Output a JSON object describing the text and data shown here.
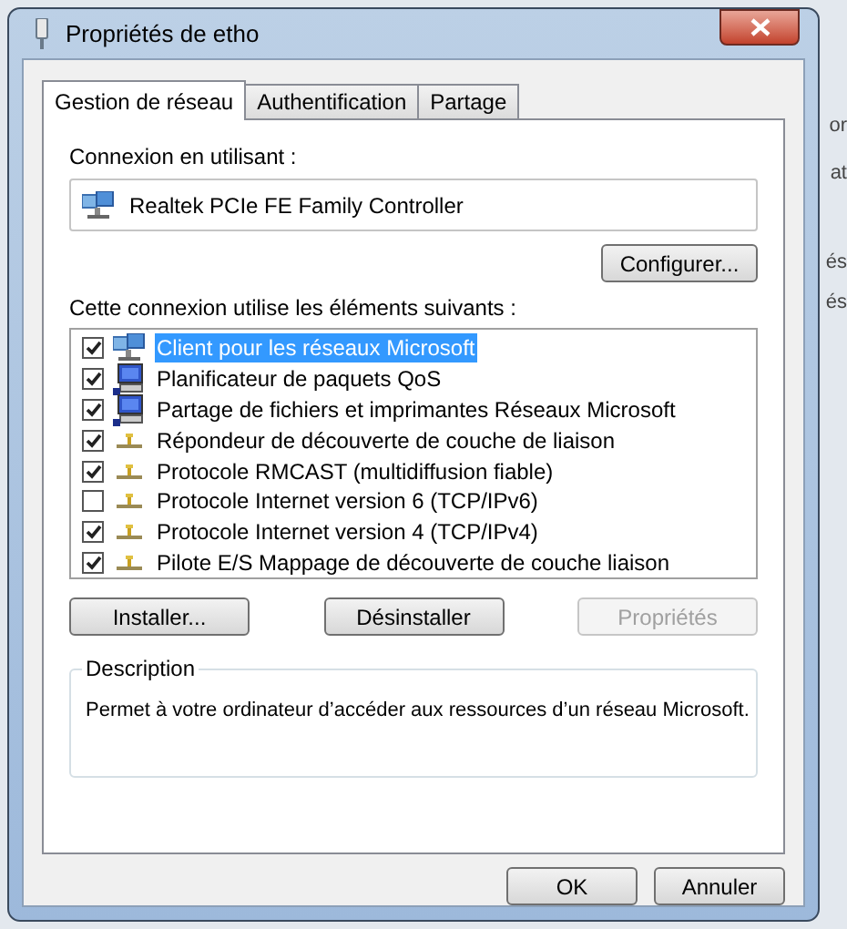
{
  "background_window": {
    "fragments": [
      "or",
      "at",
      "és",
      "és"
    ]
  },
  "window": {
    "title": "Propriétés de etho"
  },
  "tabs": [
    {
      "label": "Gestion de réseau",
      "selected": true
    },
    {
      "label": "Authentification",
      "selected": false
    },
    {
      "label": "Partage",
      "selected": false
    }
  ],
  "connection": {
    "label": "Connexion en utilisant :",
    "adapter": "Realtek PCIe FE Family Controller",
    "configure_button": "Configurer..."
  },
  "items_label": "Cette connexion utilise les éléments suivants :",
  "items": [
    {
      "label": "Client pour les réseaux Microsoft",
      "kind": "client",
      "checked": true,
      "selected": true
    },
    {
      "label": "Planificateur de paquets QoS",
      "kind": "computer",
      "checked": true,
      "selected": false
    },
    {
      "label": "Partage de fichiers et imprimantes Réseaux Microsoft",
      "kind": "computer",
      "checked": true,
      "selected": false
    },
    {
      "label": "Répondeur de découverte de couche de liaison",
      "kind": "protocol",
      "checked": true,
      "selected": false
    },
    {
      "label": "Protocole RMCAST (multidiffusion fiable)",
      "kind": "protocol",
      "checked": true,
      "selected": false
    },
    {
      "label": "Protocole Internet version 6 (TCP/IPv6)",
      "kind": "protocol",
      "checked": false,
      "selected": false
    },
    {
      "label": "Protocole Internet version 4 (TCP/IPv4)",
      "kind": "protocol",
      "checked": true,
      "selected": false
    },
    {
      "label": "Pilote E/S Mappage de découverte de couche liaison",
      "kind": "protocol",
      "checked": true,
      "selected": false
    }
  ],
  "item_buttons": [
    {
      "label": "Installer...",
      "disabled": false
    },
    {
      "label": "Désinstaller",
      "disabled": false
    },
    {
      "label": "Propriétés",
      "disabled": true
    }
  ],
  "description": {
    "title": "Description",
    "text": "Permet à votre ordinateur d’accéder aux ressources d’un réseau Microsoft."
  },
  "dialog_buttons": [
    {
      "label": "OK"
    },
    {
      "label": "Annuler"
    }
  ]
}
